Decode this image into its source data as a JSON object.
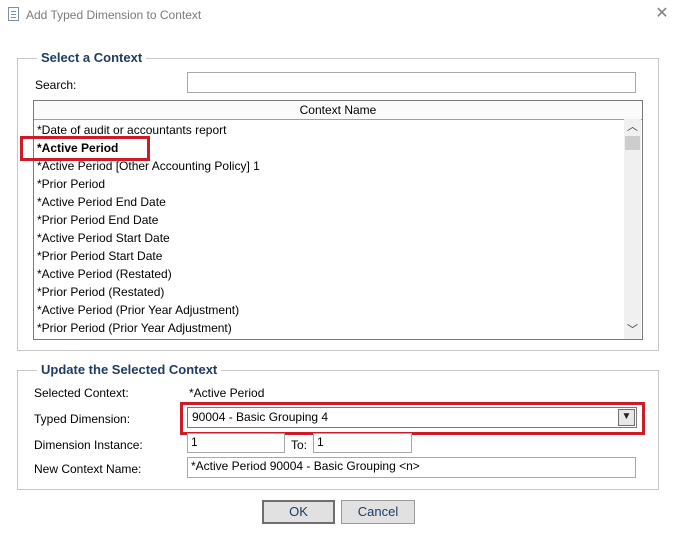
{
  "window": {
    "title": "Add Typed Dimension to Context",
    "icon": "document-icon",
    "close_glyph": "✕"
  },
  "select_context": {
    "legend": "Select a Context",
    "search_label": "Search:",
    "search_value": "",
    "list_header": "Context Name",
    "selected_index": 1,
    "items": [
      "*Date of audit or accountants report",
      "*Active Period",
      "*Active Period [Other Accounting Policy] 1",
      "*Prior Period",
      "*Active Period End Date",
      "*Prior Period End Date",
      "*Active Period Start Date",
      "*Prior Period Start Date",
      "*Active Period (Restated)",
      "*Prior Period (Restated)",
      "*Active Period (Prior Year Adjustment)",
      "*Prior Period (Prior Year Adjustment)"
    ]
  },
  "update_context": {
    "legend": "Update the Selected Context",
    "selected_context_label": "Selected Context:",
    "selected_context_value": "*Active Period",
    "typed_dimension_label": "Typed Dimension:",
    "typed_dimension_value": "90004 - Basic Grouping 4",
    "dimension_instance_label": "Dimension Instance:",
    "dimension_instance_from": "1",
    "to_label": "To:",
    "dimension_instance_to": "1",
    "new_context_name_label": "New Context Name:",
    "new_context_name_value": "*Active Period 90004 - Basic Grouping <n>"
  },
  "buttons": {
    "ok": "OK",
    "cancel": "Cancel"
  },
  "colors": {
    "highlight": "#cc1c28",
    "legend_text": "#1e3c64"
  }
}
